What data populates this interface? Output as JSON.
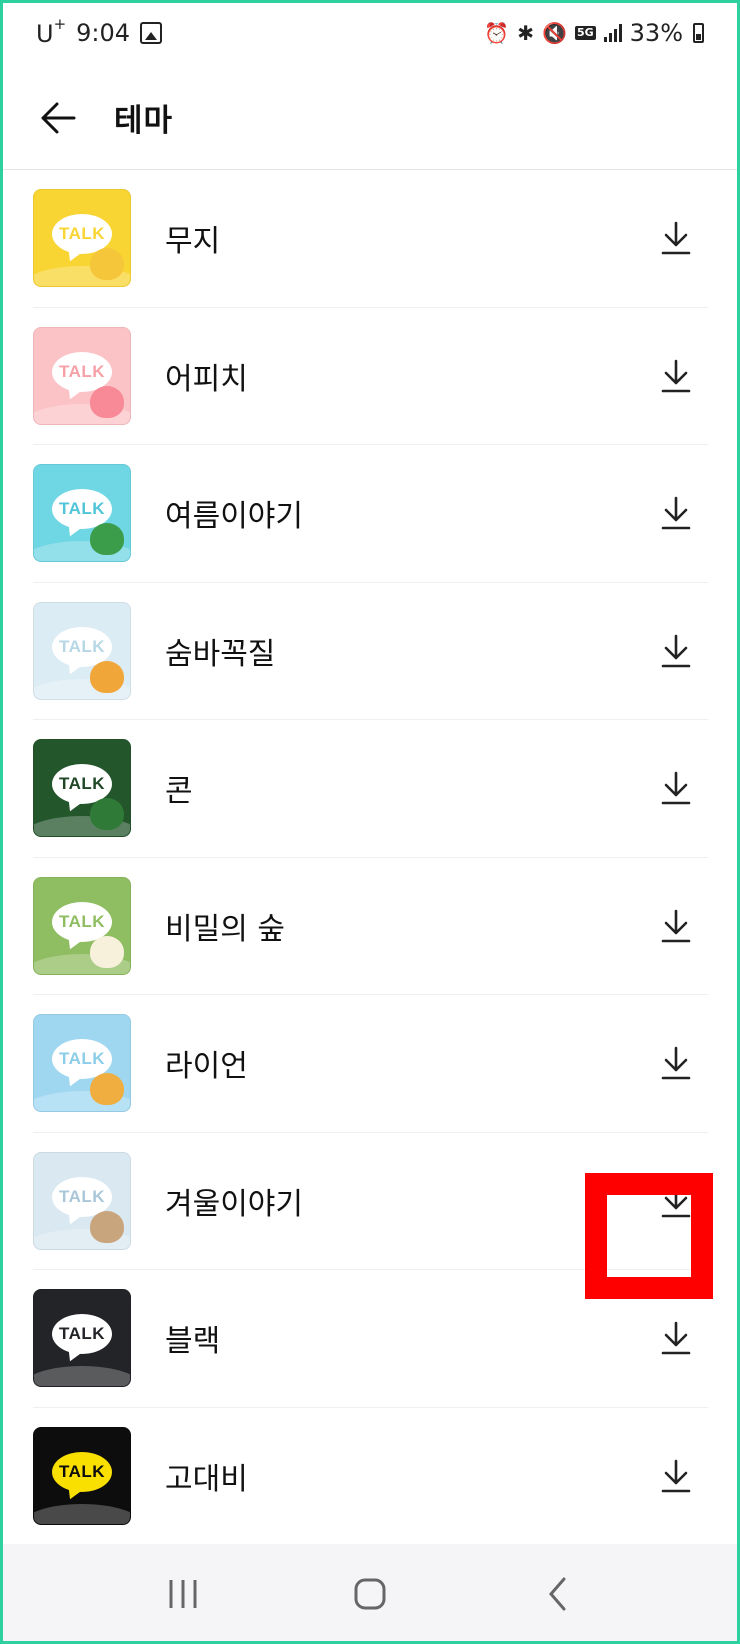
{
  "status_bar": {
    "carrier": "U",
    "carrier_sup": "+",
    "time": "9:04",
    "network": "5G",
    "battery": "33%",
    "icons": [
      "gallery-icon",
      "alarm-icon",
      "bluetooth-icon",
      "mute-icon",
      "5g-icon",
      "signal-icon",
      "battery-icon"
    ]
  },
  "header": {
    "title": "테마",
    "back_icon": "arrow-left-icon"
  },
  "themes": [
    {
      "label": "무지",
      "thumb_text": "TALK",
      "bg": "#f9d533",
      "text_color": "#f9d533",
      "mascot": "#f6c63a"
    },
    {
      "label": "어피치",
      "thumb_text": "TALK",
      "bg": "#fcc3c6",
      "text_color": "#f6a0a8",
      "mascot": "#f78a96"
    },
    {
      "label": "여름이야기",
      "thumb_text": "TALK",
      "bg": "#6fd6e4",
      "text_color": "#4fc6d8",
      "mascot": "#3b9c4a"
    },
    {
      "label": "숨바꼭질",
      "thumb_text": "TALK",
      "bg": "#dcecf4",
      "text_color": "#b7d7e6",
      "mascot": "#f1a63a"
    },
    {
      "label": "콘",
      "thumb_text": "TALK",
      "bg": "#24562c",
      "text_color": "#1f4726",
      "mascot": "#2e7a36"
    },
    {
      "label": "비밀의 숲",
      "thumb_text": "TALK",
      "bg": "#8fbd61",
      "text_color": "#8fbd61",
      "mascot": "#f7f1dc"
    },
    {
      "label": "라이언",
      "thumb_text": "TALK",
      "bg": "#9fd7f1",
      "text_color": "#8ccde9",
      "mascot": "#f1ae40"
    },
    {
      "label": "겨울이야기",
      "thumb_text": "TALK",
      "bg": "#d9e8f1",
      "text_color": "#aac7d9",
      "mascot": "#c9a57d"
    },
    {
      "label": "블랙",
      "thumb_text": "TALK",
      "bg": "#232427",
      "text_color": "#232427",
      "mascot": "#232427"
    },
    {
      "label": "고대비",
      "thumb_text": "TALK",
      "bg": "#0d0d0d",
      "text_color": "#0d0d0d",
      "mascot": "#0d0d0d",
      "bubble_bg": "#f9e000"
    }
  ],
  "download_icon": "download-icon",
  "highlight_color": "#ff0000",
  "nav_bar": {
    "icons": [
      "recent-apps-icon",
      "home-icon",
      "back-icon"
    ]
  }
}
